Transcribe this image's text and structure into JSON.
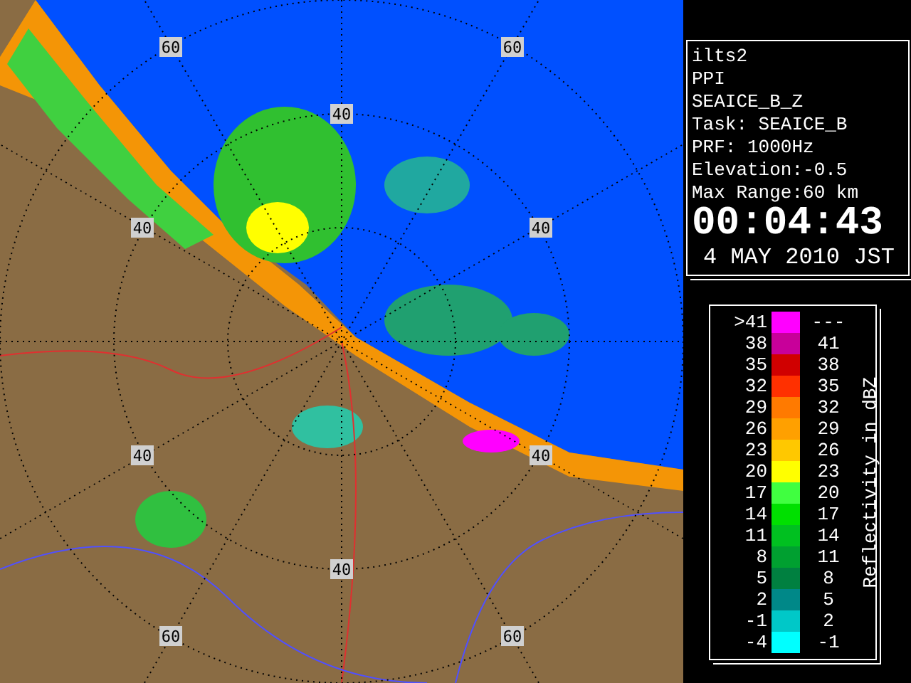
{
  "radar_map": {
    "range_labels": [
      "60",
      "60",
      "40",
      "40",
      "40",
      "40",
      "40",
      "40",
      "60",
      "60"
    ]
  },
  "info_panel": {
    "lines": [
      "ilts2",
      "PPI",
      "SEAICE_B_Z",
      "Task: SEAICE_B",
      "PRF: 1000Hz",
      "Elevation:-0.5",
      "Max Range:60 km"
    ],
    "time": "00:04:43",
    "date": "4 MAY 2010 JST"
  },
  "legend": {
    "title": "Reflectivity in dBZ",
    "rows": [
      {
        "low": ">41",
        "high": "---",
        "color": "#ff00ff"
      },
      {
        "low": "38",
        "high": "41",
        "color": "#c8009a"
      },
      {
        "low": "35",
        "high": "38",
        "color": "#d00000"
      },
      {
        "low": "32",
        "high": "35",
        "color": "#ff3000"
      },
      {
        "low": "29",
        "high": "32",
        "color": "#ff7a00"
      },
      {
        "low": "26",
        "high": "29",
        "color": "#ffa000"
      },
      {
        "low": "23",
        "high": "26",
        "color": "#ffc800"
      },
      {
        "low": "20",
        "high": "23",
        "color": "#ffff00"
      },
      {
        "low": "17",
        "high": "20",
        "color": "#40ff40"
      },
      {
        "low": "14",
        "high": "17",
        "color": "#00e000"
      },
      {
        "low": "11",
        "high": "14",
        "color": "#00c020"
      },
      {
        "low": "8",
        "high": "11",
        "color": "#00a030"
      },
      {
        "low": "5",
        "high": "8",
        "color": "#008040"
      },
      {
        "low": "2",
        "high": "5",
        "color": "#008888"
      },
      {
        "low": "-1",
        "high": "2",
        "color": "#00c8c8"
      },
      {
        "low": "-4",
        "high": "-1",
        "color": "#00ffff"
      }
    ]
  }
}
